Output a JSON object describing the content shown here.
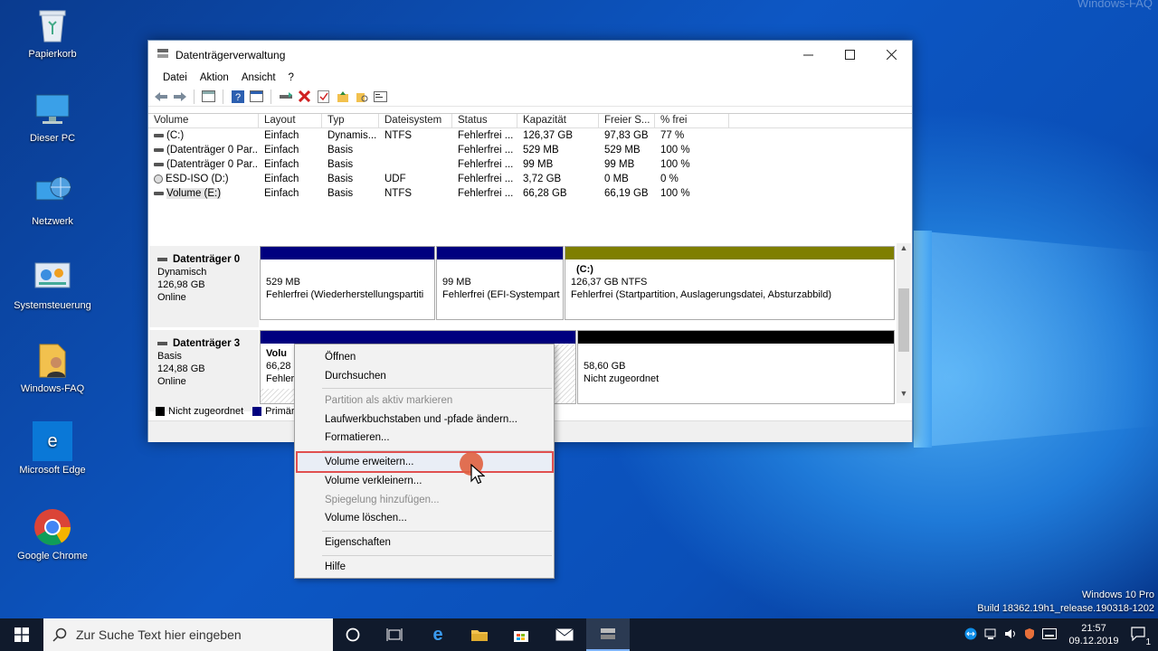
{
  "desktop": {
    "watermark": "Windows-FAQ",
    "icons": [
      {
        "label": "Papierkorb"
      },
      {
        "label": "Dieser PC"
      },
      {
        "label": "Netzwerk"
      },
      {
        "label": "Systemsteuerung"
      },
      {
        "label": "Windows-FAQ"
      },
      {
        "label": "Microsoft Edge"
      },
      {
        "label": "Google Chrome"
      }
    ],
    "os_name": "Windows 10 Pro",
    "build": "Build 18362.19h1_release.190318-1202"
  },
  "window": {
    "title": "Datenträgerverwaltung",
    "menu": [
      "Datei",
      "Aktion",
      "Ansicht",
      "?"
    ],
    "columns": [
      "Volume",
      "Layout",
      "Typ",
      "Dateisystem",
      "Status",
      "Kapazität",
      "Freier S...",
      "% frei"
    ],
    "volumes": [
      [
        "(C:)",
        "Einfach",
        "Dynamis...",
        "NTFS",
        "Fehlerfrei ...",
        "126,37 GB",
        "97,83 GB",
        "77 %"
      ],
      [
        "(Datenträger 0 Par...",
        "Einfach",
        "Basis",
        "",
        "Fehlerfrei ...",
        "529 MB",
        "529 MB",
        "100 %"
      ],
      [
        "(Datenträger 0 Par...",
        "Einfach",
        "Basis",
        "",
        "Fehlerfrei ...",
        "99 MB",
        "99 MB",
        "100 %"
      ],
      [
        "ESD-ISO (D:)",
        "Einfach",
        "Basis",
        "UDF",
        "Fehlerfrei ...",
        "3,72 GB",
        "0 MB",
        "0 %"
      ],
      [
        "Volume (E:)",
        "Einfach",
        "Basis",
        "NTFS",
        "Fehlerfrei ...",
        "66,28 GB",
        "66,19 GB",
        "100 %"
      ]
    ],
    "disks": [
      {
        "name": "Datenträger 0",
        "type": "Dynamisch",
        "size": "126,98 GB",
        "state": "Online",
        "partitions": [
          {
            "title": "",
            "line1": "529 MB",
            "line2": "Fehlerfrei (Wiederherstellungspartiti"
          },
          {
            "title": "",
            "line1": "99 MB",
            "line2": "Fehlerfrei (EFI-Systempart"
          },
          {
            "title": "(C:)",
            "line1": "126,37 GB NTFS",
            "line2": "Fehlerfrei (Startpartition, Auslagerungsdatei, Absturzabbild)"
          }
        ]
      },
      {
        "name": "Datenträger 3",
        "type": "Basis",
        "size": "124,88 GB",
        "state": "Online",
        "partitions": [
          {
            "title": "Volu",
            "line1": "66,28 G",
            "line2": "Fehler"
          },
          {
            "title": "",
            "line1": "58,60 GB",
            "line2": "Nicht zugeordnet"
          }
        ]
      }
    ],
    "legend": [
      {
        "label": "Nicht zugeordnet",
        "color": "#000000"
      },
      {
        "label": "Primär",
        "color": "#00007f"
      }
    ],
    "colors": {
      "primary": "#00007f",
      "dynamic": "#7f7f00",
      "unallocated": "#000000"
    }
  },
  "context_menu": {
    "items": [
      {
        "label": "Öffnen",
        "enabled": true
      },
      {
        "label": "Durchsuchen",
        "enabled": true
      },
      {
        "label": "Partition als aktiv markieren",
        "enabled": false
      },
      {
        "label": "Laufwerkbuchstaben und -pfade ändern...",
        "enabled": true
      },
      {
        "label": "Formatieren...",
        "enabled": true
      },
      {
        "label": "Volume erweitern...",
        "enabled": true,
        "highlighted": true
      },
      {
        "label": "Volume verkleinern...",
        "enabled": true
      },
      {
        "label": "Spiegelung hinzufügen...",
        "enabled": false
      },
      {
        "label": "Volume löschen...",
        "enabled": true
      },
      {
        "label": "Eigenschaften",
        "enabled": true
      },
      {
        "label": "Hilfe",
        "enabled": true
      }
    ]
  },
  "taskbar": {
    "search_placeholder": "Zur Suche Text hier eingeben",
    "time": "21:57",
    "date": "09.12.2019",
    "notification_count": "1"
  }
}
